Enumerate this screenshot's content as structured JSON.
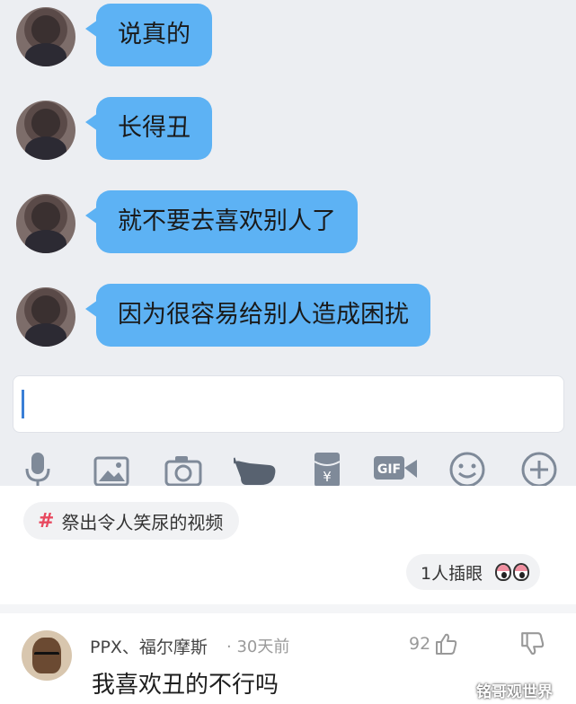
{
  "chat": {
    "messages": [
      {
        "text": "说真的"
      },
      {
        "text": "长得丑"
      },
      {
        "text": "就不要去喜欢别人了"
      },
      {
        "text": "因为很容易给别人造成困扰"
      }
    ],
    "bubble_color": "#5db2f4",
    "background_color": "#eceef2"
  },
  "input": {
    "value": ""
  },
  "toolbar": {
    "icons": [
      "microphone-icon",
      "image-icon",
      "camera-icon",
      "hand-icon",
      "red-packet-icon",
      "gif-icon",
      "emoji-icon",
      "plus-icon"
    ],
    "gif_label": "GIF",
    "red_packet_symbol": "¥"
  },
  "post": {
    "topic_symbol": "#",
    "topic": "祭出令人笑尿的视频",
    "insert_label": "1人插眼"
  },
  "comment": {
    "author": "PPX、福尔摩斯",
    "separator": "·",
    "time": "30天前",
    "likes": "92",
    "text": "我喜欢丑的不行吗"
  },
  "watermark": "铭哥观世界"
}
